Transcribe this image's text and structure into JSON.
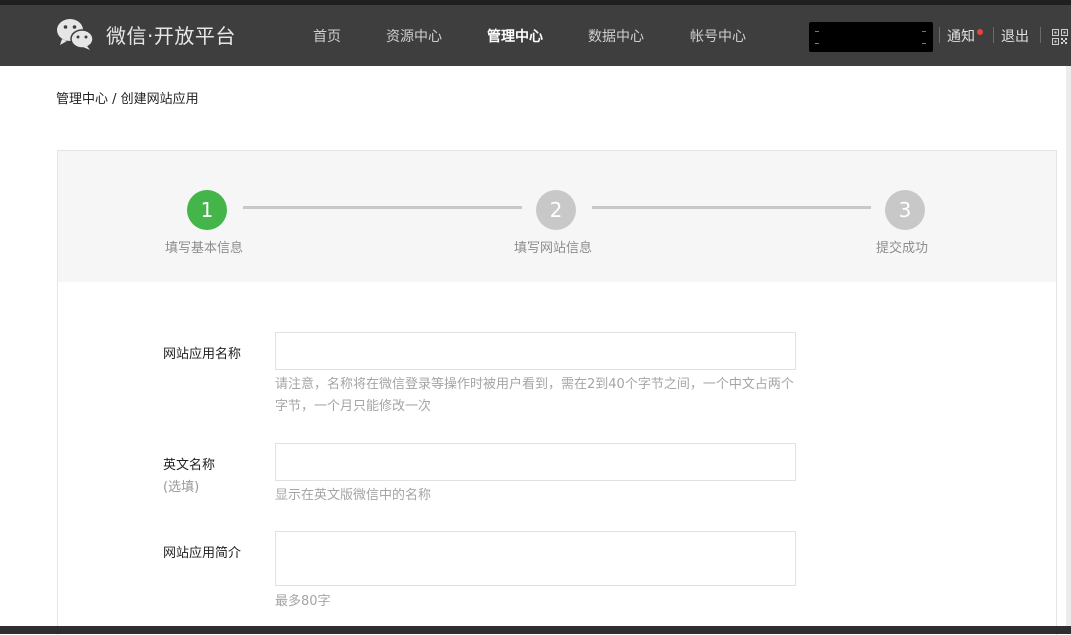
{
  "header": {
    "brand": "微信·开放平台",
    "nav": [
      {
        "label": "首页"
      },
      {
        "label": "资源中心"
      },
      {
        "label": "管理中心"
      },
      {
        "label": "数据中心"
      },
      {
        "label": "帐号中心"
      }
    ],
    "notify_label": "通知",
    "logout_label": "退出"
  },
  "breadcrumb": {
    "parent": "管理中心",
    "separator": " / ",
    "current": "创建网站应用"
  },
  "steps": [
    {
      "number": "1",
      "label": "填写基本信息",
      "state": "done"
    },
    {
      "number": "2",
      "label": "填写网站信息",
      "state": "todo"
    },
    {
      "number": "3",
      "label": "提交成功",
      "state": "todo"
    }
  ],
  "form": {
    "app_name": {
      "label": "网站应用名称",
      "value": "",
      "tip": "请注意，名称将在微信登录等操作时被用户看到，需在2到40个字节之间，一个中文占两个字节，一个月只能修改一次"
    },
    "english_name": {
      "label": "英文名称",
      "optional": "(选填)",
      "value": "",
      "tip": "显示在英文版微信中的名称"
    },
    "intro": {
      "label": "网站应用简介",
      "value": "",
      "tip": "最多80字"
    }
  },
  "colors": {
    "header_bg": "#3e3e3e",
    "accent_green": "#44b549",
    "inactive_step": "#c8c8c8",
    "notify_dot": "#e64340"
  }
}
